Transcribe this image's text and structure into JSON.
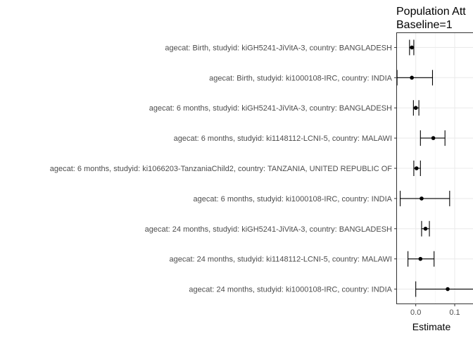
{
  "chart_data": {
    "type": "forest",
    "title_lines": [
      "Population Att",
      "Baseline=1"
    ],
    "xlabel": "Estimate",
    "xlim": [
      -0.05,
      0.165
    ],
    "x_ticks": [
      0.0,
      0.1
    ],
    "x_tick_labels": [
      "0.0",
      "0.1"
    ],
    "grid": true,
    "categories": [
      "agecat: Birth, studyid: kiGH5241-JiVitA-3, country: BANGLADESH",
      "agecat: Birth, studyid: ki1000108-IRC, country: INDIA",
      "agecat: 6 months, studyid: kiGH5241-JiVitA-3, country: BANGLADESH",
      "agecat: 6 months, studyid: ki1148112-LCNI-5, country: MALAWI",
      "agecat: 6 months, studyid: ki1066203-TanzaniaChild2, country: TANZANIA, UNITED REPUBLIC OF",
      "agecat: 6 months, studyid: ki1000108-IRC, country: INDIA",
      "agecat: 24 months, studyid: kiGH5241-JiVitA-3, country: BANGLADESH",
      "agecat: 24 months, studyid: ki1148112-LCNI-5, country: MALAWI",
      "agecat: 24 months, studyid: ki1000108-IRC, country: INDIA"
    ],
    "estimates": [
      -0.01,
      -0.01,
      0.0,
      0.045,
      0.002,
      0.015,
      0.025,
      0.012,
      0.082
    ],
    "ci_lower": [
      -0.016,
      -0.048,
      -0.006,
      0.012,
      -0.005,
      -0.04,
      0.015,
      -0.02,
      0.0
    ],
    "ci_upper": [
      -0.005,
      0.043,
      0.008,
      0.075,
      0.012,
      0.087,
      0.035,
      0.047,
      0.165
    ]
  }
}
